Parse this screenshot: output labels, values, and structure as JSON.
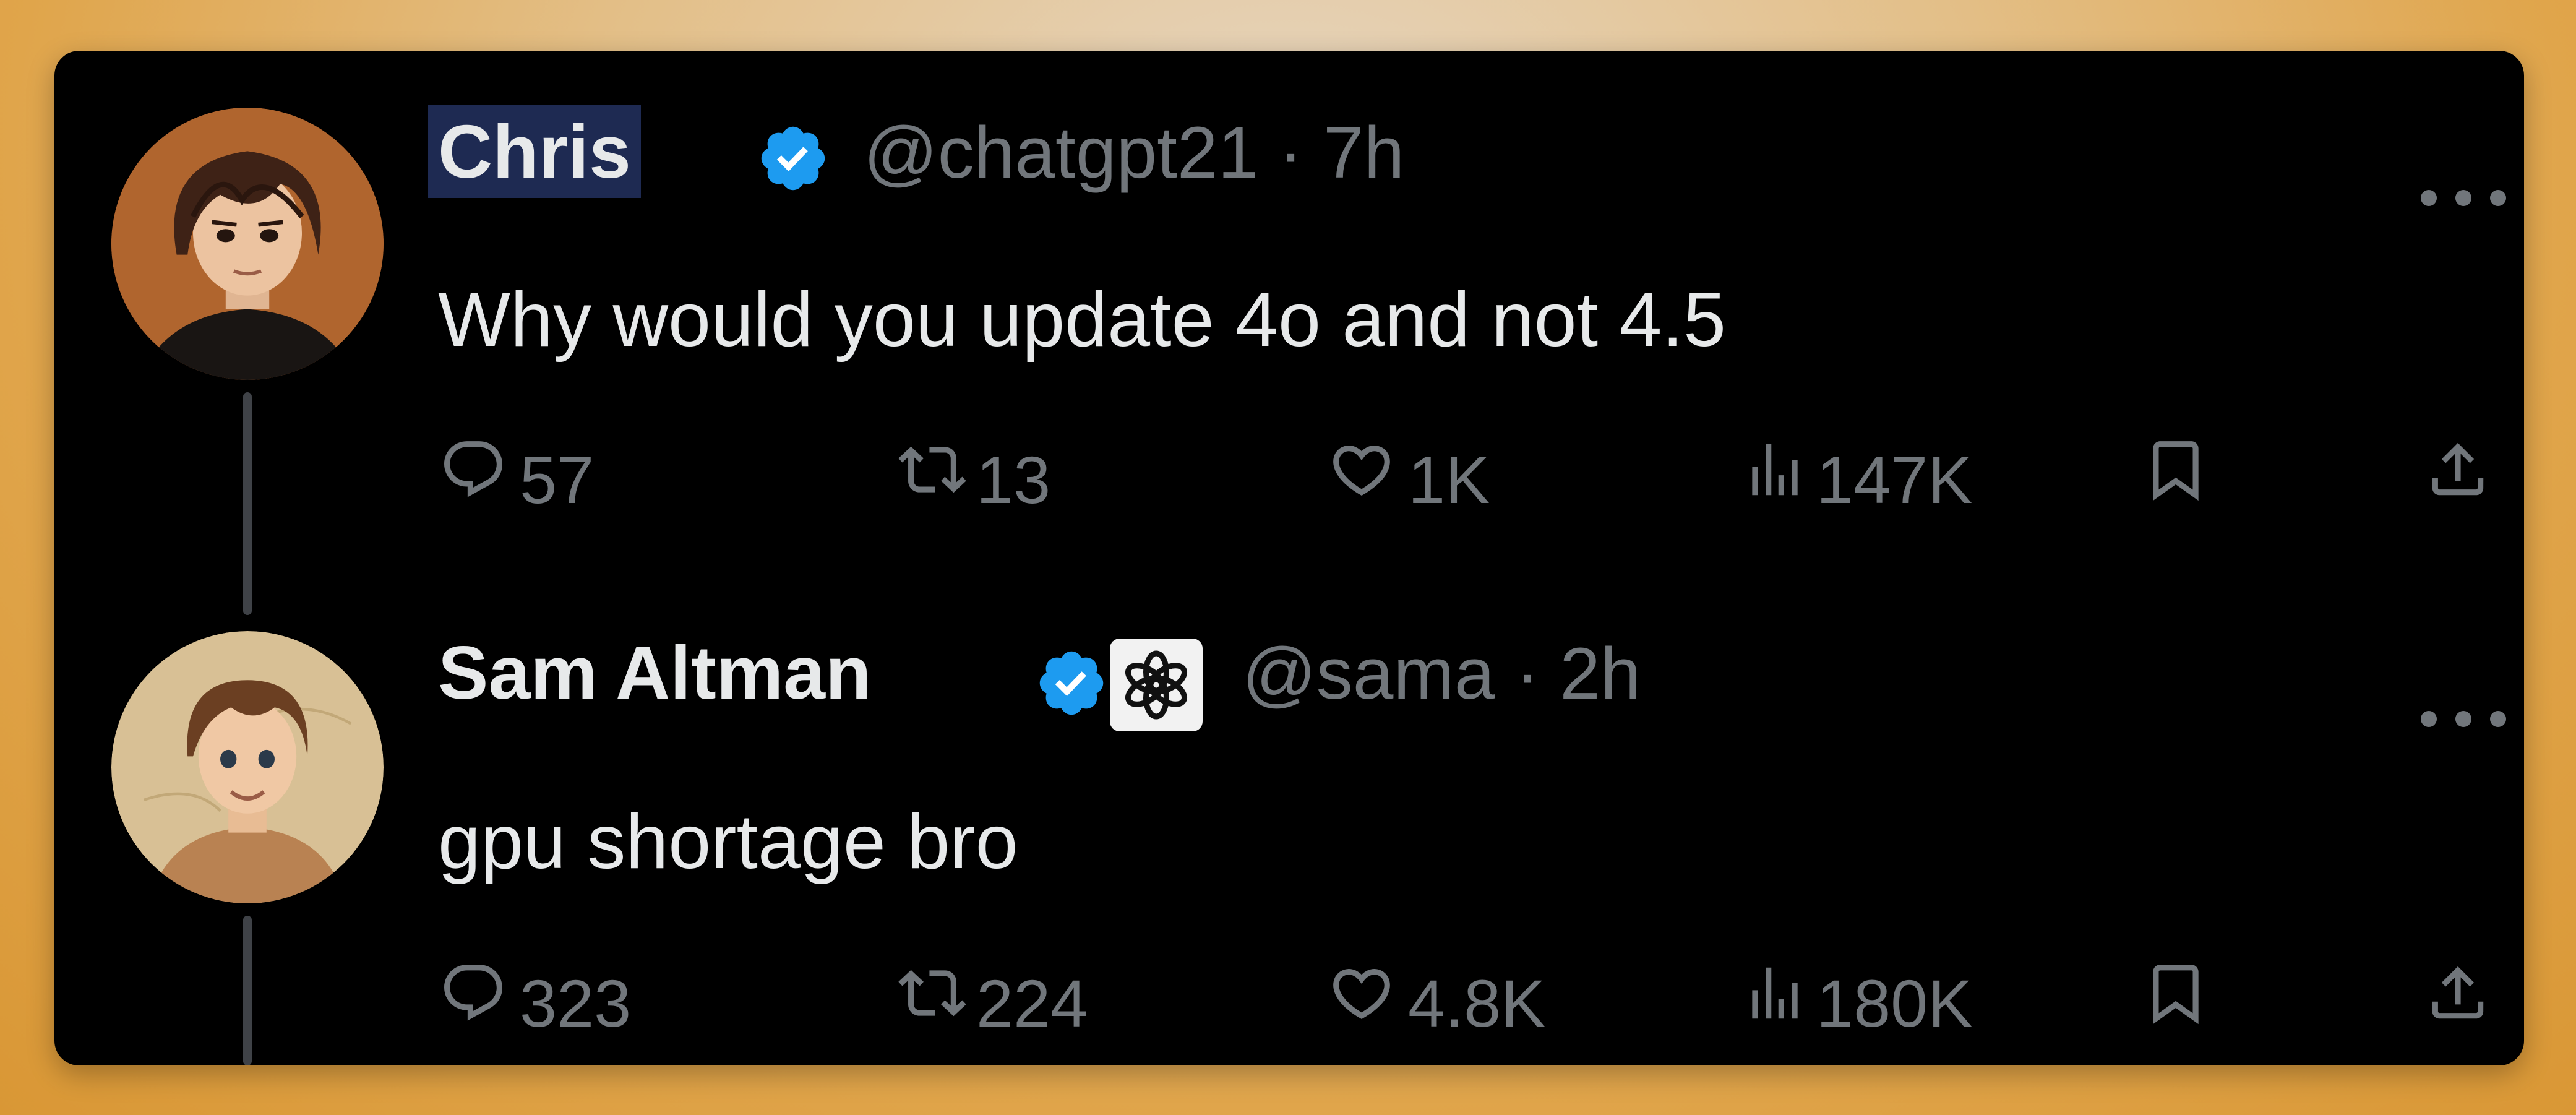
{
  "tweets": [
    {
      "name": "Chris",
      "handle": "@chatgpt21",
      "sep": "·",
      "time": "7h",
      "text": "Why would you update 4o and not 4.5",
      "replies": "57",
      "reposts": "13",
      "likes": "1K",
      "views": "147K"
    },
    {
      "name": "Sam Altman",
      "handle": "@sama",
      "sep": "·",
      "time": "2h",
      "text": "gpu shortage bro",
      "replies": "323",
      "reposts": "224",
      "likes": "4.8K",
      "views": "180K"
    }
  ],
  "colors": {
    "background": "#000000",
    "primary_text": "#e7e9ea",
    "secondary_text": "#71767b",
    "verified_badge": "#1d9bf0",
    "thread_line": "#3f4247"
  },
  "icons": [
    "reply-icon",
    "repost-icon",
    "like-icon",
    "views-icon",
    "bookmark-icon",
    "share-icon",
    "more-icon",
    "verified-badge-icon",
    "openai-affiliate-badge-icon"
  ]
}
